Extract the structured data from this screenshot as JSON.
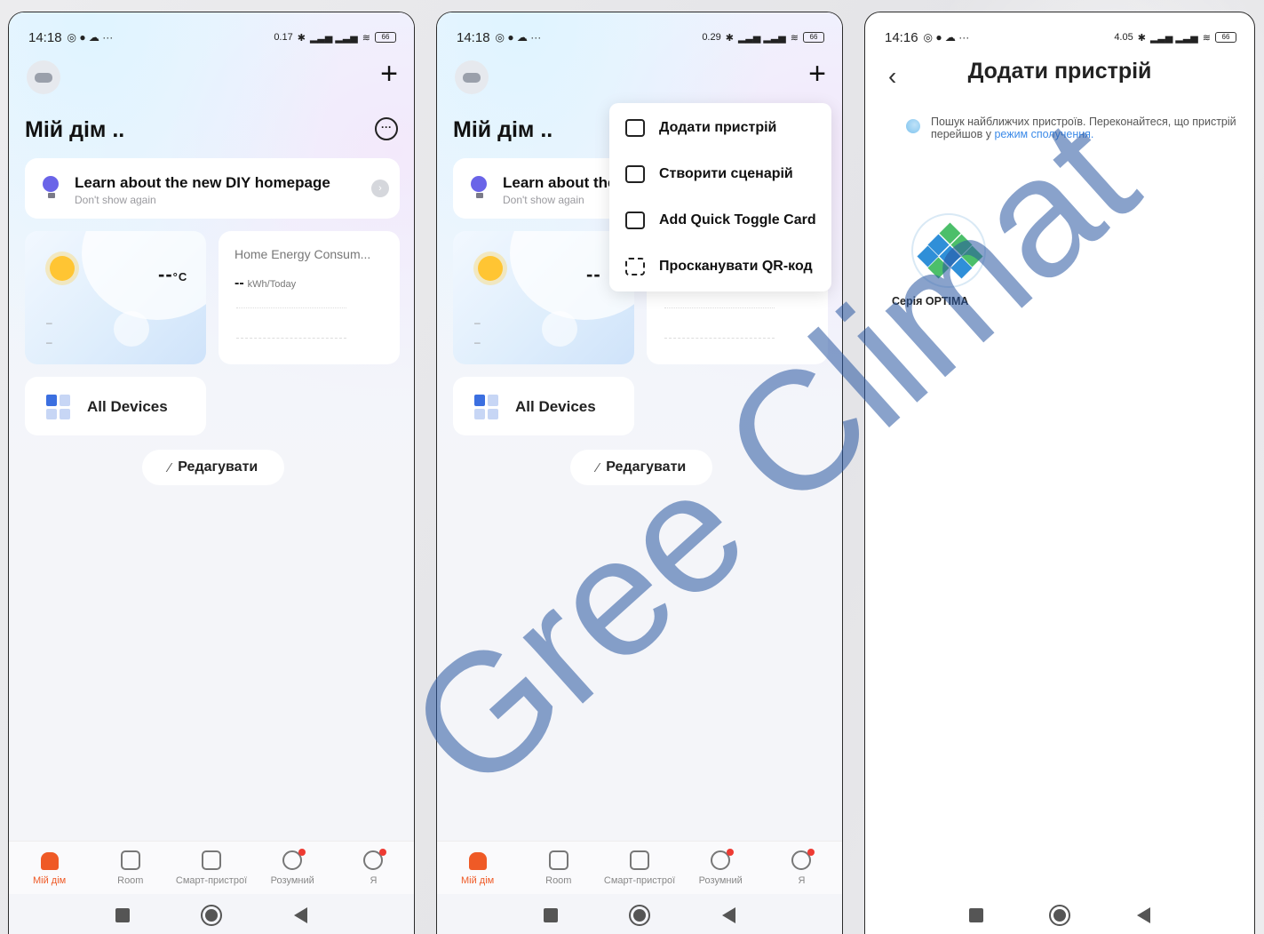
{
  "status": {
    "time_a": "14:18",
    "time_b": "14:18",
    "time_c": "14:16",
    "net_a": "0.17",
    "net_b": "0.29",
    "net_c": "4.05",
    "battery": "66"
  },
  "home": {
    "title": "Мій дім ..",
    "learn_title": "Learn about the new DIY homepage",
    "learn_title_cut": "Learn about the",
    "learn_sub": "Don't show again",
    "temp": "--",
    "temp_cut": "--",
    "temp_unit": "°C",
    "energy_title": "Home Energy Consum...",
    "energy_value": "--",
    "energy_unit": "kWh/Today",
    "weather_dash": "–",
    "all_devices": "All Devices",
    "edit": "Редагувати"
  },
  "tabs": [
    "Мій дім",
    "Room",
    "Смарт-пристрої",
    "Розумний",
    "Я"
  ],
  "menu": [
    "Додати пристрій",
    "Створити сценарій",
    "Add Quick Toggle Card",
    "Просканувати QR-код"
  ],
  "add_device": {
    "title": "Додати пристрій",
    "search_text": "Пошук найближчих пристроїв. Переконайтеся, що пристрій перейшов у",
    "search_link": "режим сполучення.",
    "device_label": "Серія OPTIMA"
  },
  "watermark": "Gree Climat",
  "colors": {
    "accent": "#ef5a26",
    "link": "#3d8be8",
    "bulb": "#6a64e8",
    "optima_blue": "#2f8fd8",
    "optima_green": "#4cbf6a"
  }
}
